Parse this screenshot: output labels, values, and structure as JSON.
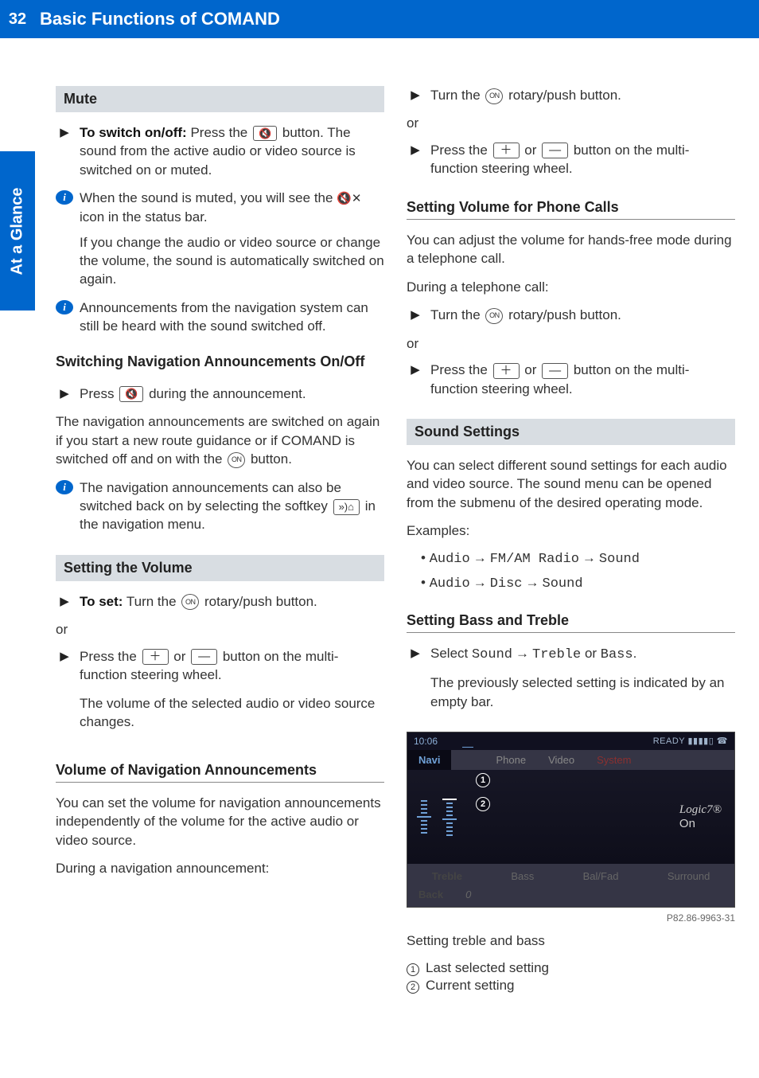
{
  "page_number": "32",
  "header_title": "Basic Functions of COMAND",
  "side_tab": "At a Glance",
  "icons": {
    "plus": "＋",
    "minus": "—",
    "on": "ON",
    "mute": "🔇",
    "nav_announce": "»)⌂"
  },
  "left": {
    "mute_heading": "Mute",
    "mute_step_lead": "To switch on/off:",
    "mute_step_tail1": " Press the ",
    "mute_step_tail2": " button. The sound from the active audio or video source is switched on or muted.",
    "mute_info1_a": "When the sound is muted, you will see the ",
    "mute_info1_b": " icon in the status bar.",
    "mute_info1_c": "If you change the audio or video source or change the volume, the sound is automatically switched on again.",
    "mute_info2": "Announcements from the navigation system can still be heard with the sound switched off.",
    "nav_heading": "Switching Navigation Announcements On/Off",
    "nav_step_a": "Press ",
    "nav_step_b": " during the announcement.",
    "nav_para_a": "The navigation announcements are switched on again if you start a new route guidance or if COMAND is switched off and on with the ",
    "nav_para_b": " button.",
    "nav_info_a": "The navigation announcements can also be switched back on by selecting the softkey ",
    "nav_info_b": " in the navigation menu.",
    "vol_heading": "Setting the Volume",
    "vol_step_lead": "To set:",
    "vol_step_tail": " Turn the ",
    "vol_step_tail2": " rotary/push button.",
    "or": "or",
    "vol_step2_a": "Press the ",
    "vol_step2_b": " or ",
    "vol_step2_c": " button on the multi-function steering wheel.",
    "vol_step2_d": "The volume of the selected audio or video source changes.",
    "nav_vol_heading": "Volume of Navigation Announcements",
    "nav_vol_para": "You can set the volume for navigation announcements independently of the volume for the active audio or video source.",
    "nav_vol_para2": "During a navigation announcement:"
  },
  "right": {
    "turn_step_a": "Turn the ",
    "turn_step_b": " rotary/push button.",
    "or": "or",
    "press_step_a": "Press the ",
    "press_step_b": " or ",
    "press_step_c": " button on the multi-function steering wheel.",
    "phone_heading": "Setting Volume for Phone Calls",
    "phone_para1": "You can adjust the volume for hands-free mode during a telephone call.",
    "phone_para2": "During a telephone call:",
    "sound_heading": "Sound Settings",
    "sound_para": "You can select different sound settings for each audio and video source. The sound menu can be opened from the submenu of the desired operating mode.",
    "examples": "Examples:",
    "ex1_a": "Audio",
    "ex1_b": "FM/AM Radio",
    "ex1_c": "Sound",
    "ex2_a": "Audio",
    "ex2_b": "Disc",
    "ex2_c": "Sound",
    "bass_heading": "Setting Bass and Treble",
    "bass_step_a": "Select ",
    "bass_step_b": "Sound",
    "bass_step_c": "Treble",
    "bass_step_or": " or ",
    "bass_step_d": "Bass",
    "bass_step_e": ".",
    "bass_step_f": "The previously selected setting is indicated by an empty bar.",
    "screenshot": {
      "time": "10:06",
      "ready": "READY ▮▮▮▮▯ ☎",
      "tabs": {
        "navi": "Navi",
        "phone": "Phone",
        "video": "Video",
        "system": "System"
      },
      "logic7": "Logic7®",
      "on": "On",
      "bottom": {
        "treble": "Treble",
        "bass": "Bass",
        "balfad": "Bal/Fad",
        "surround": "Surround",
        "back": "Back",
        "zero": "0"
      }
    },
    "fig_code": "P82.86-9963-31",
    "caption": "Setting treble and bass",
    "legend1": "Last selected setting",
    "legend2": "Current setting"
  }
}
